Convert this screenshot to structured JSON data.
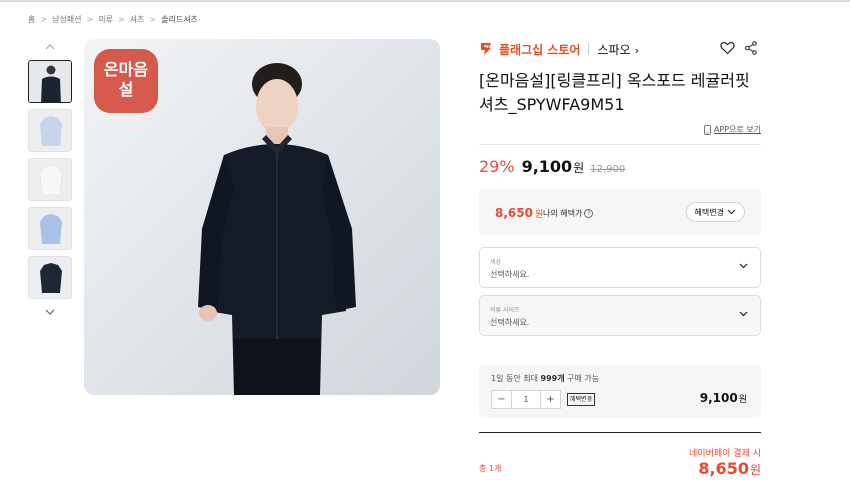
{
  "breadcrumb": {
    "items": [
      "홈",
      "남성패션",
      "의류",
      "셔츠",
      "솔리드셔츠"
    ]
  },
  "gallery": {
    "badge_line1": "온마음",
    "badge_line2": "설"
  },
  "store": {
    "name": "플래그십 스토어",
    "brand": "스파오",
    "brand_arrow": "›",
    "accent": "#e25227"
  },
  "product": {
    "title": "[온마음설][링클프리] 옥스포드 레귤러핏 셔츠_SPYWFA9M51",
    "app_link": "APP으로 보기"
  },
  "price": {
    "discount": "29%",
    "sale": "9,100",
    "won": "원",
    "original": "12,900",
    "accent": "#e94a33"
  },
  "benefit": {
    "price": "8,650",
    "won": "원",
    "label": "나의 혜택가",
    "help": "?",
    "button": "혜택변경"
  },
  "options": {
    "color": {
      "label": "색상",
      "placeholder": "선택하세요."
    },
    "size": {
      "label": "의류 사이즈",
      "placeholder": "선택하세요."
    }
  },
  "quantity": {
    "note_pre": "1일 동안 최대 ",
    "note_bold": "999개",
    "note_post": " 구매 가능",
    "minus": "−",
    "value": "1",
    "plus": "+",
    "tag": "혜택변경",
    "price": "9,100",
    "won": "원"
  },
  "total": {
    "pay_label": "네이버페이 결제 시",
    "count": "총 1개",
    "price": "8,650",
    "won": "원"
  }
}
